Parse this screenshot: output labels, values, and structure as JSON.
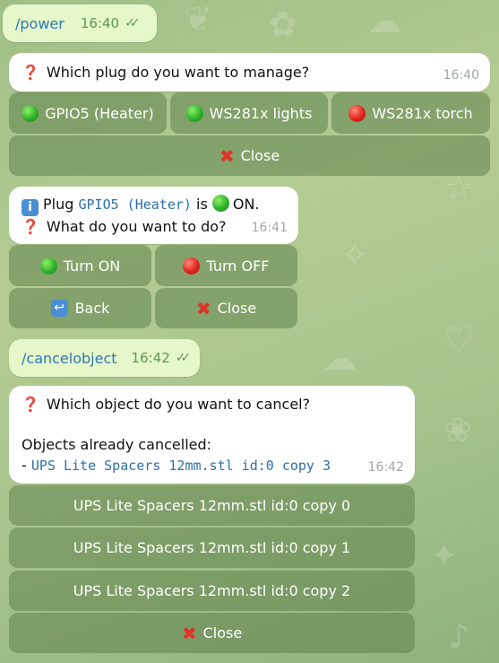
{
  "messages": {
    "power_cmd": {
      "text": "/power",
      "time": "16:40"
    },
    "plug_prompt": {
      "question": "Which plug do you want to manage?",
      "time": "16:40"
    },
    "plug_status": {
      "prefix": "Plug",
      "plug_name": "GPIO5 (Heater)",
      "mid": "is",
      "state": "ON.",
      "question": "What do you want to do?",
      "time": "16:41"
    },
    "cancel_cmd": {
      "text": "/cancelobject",
      "time": "16:42"
    },
    "cancel_prompt": {
      "question": "Which object do you want to cancel?",
      "already_label": "Objects already cancelled:",
      "cancelled_prefix": "-",
      "cancelled_item": "UPS Lite Spacers 12mm.stl id:0 copy 3",
      "time": "16:42"
    }
  },
  "keyboards": {
    "plugs": {
      "gpio5": "GPIO5 (Heater)",
      "ws_lights": "WS281x lights",
      "ws_torch": "WS281x torch",
      "close": "Close"
    },
    "plug_actions": {
      "turn_on": "Turn ON",
      "turn_off": "Turn OFF",
      "back": "Back",
      "close": "Close"
    },
    "objects": {
      "copy0": "UPS Lite Spacers 12mm.stl id:0 copy 0",
      "copy1": "UPS Lite Spacers 12mm.stl id:0 copy 1",
      "copy2": "UPS Lite Spacers 12mm.stl id:0 copy 2",
      "close": "Close"
    }
  },
  "colors": {
    "outgoing_bubble": "#e6f7c9",
    "incoming_bubble": "#ffffff",
    "keyboard_button": "#60824c",
    "link_blue": "#2d79b8",
    "status_green": "#2fb12a",
    "status_red": "#e0251c"
  },
  "icons": {
    "read_receipt": "double-check-icon",
    "question": "red-question-mark-icon",
    "info": "info-icon",
    "close": "red-x-icon",
    "back": "back-arrow-icon",
    "on": "green-circle-icon",
    "off": "red-circle-icon"
  }
}
